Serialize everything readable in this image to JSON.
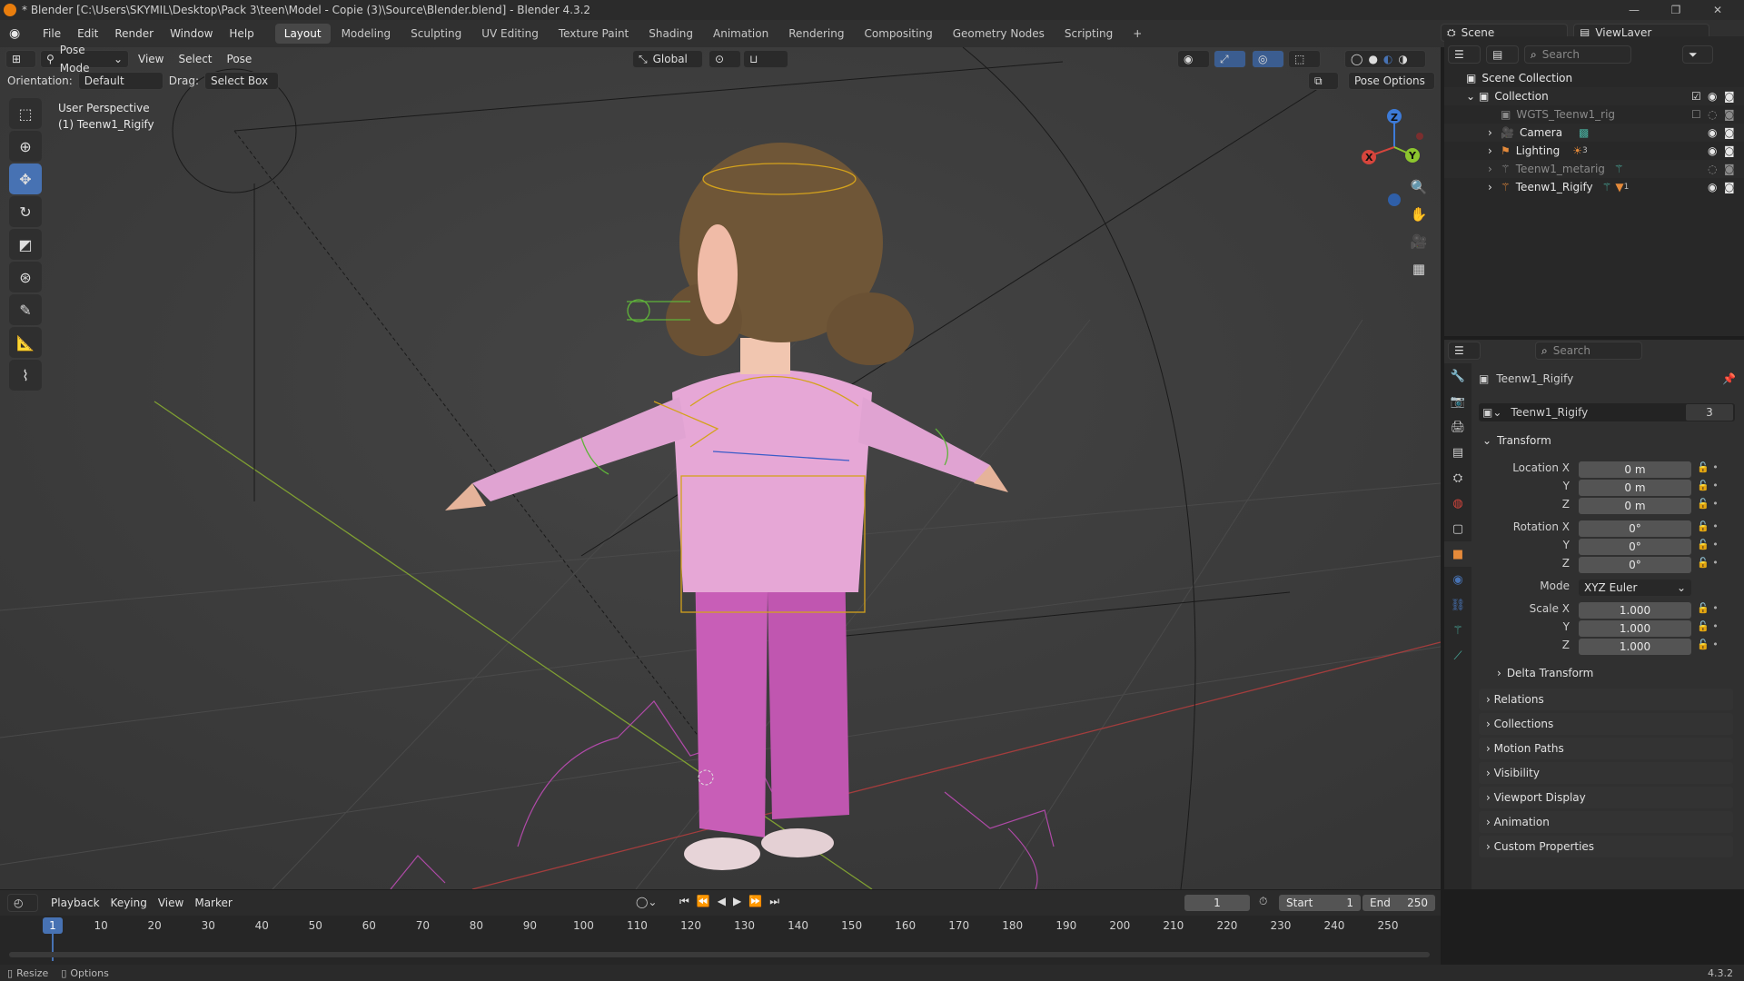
{
  "window": {
    "title": "* Blender [C:\\Users\\SKYMIL\\Desktop\\Pack 3\\teen\\Model - Copie (3)\\Source\\Blender.blend] - Blender 4.3.2",
    "minimize": "—",
    "maximize": "❐",
    "close": "✕"
  },
  "menus": [
    "File",
    "Edit",
    "Render",
    "Window",
    "Help"
  ],
  "workspaces": [
    "Layout",
    "Modeling",
    "Sculpting",
    "UV Editing",
    "Texture Paint",
    "Shading",
    "Animation",
    "Rendering",
    "Compositing",
    "Geometry Nodes",
    "Scripting"
  ],
  "active_workspace": "Layout",
  "add_workspace": "+",
  "scene": {
    "name": "Scene",
    "view_layer": "ViewLayer"
  },
  "viewport": {
    "mode": "Pose Mode",
    "menus": [
      "View",
      "Select",
      "Pose"
    ],
    "transform_orientation": "Global",
    "orientation_label": "Orientation:",
    "orientation_value": "Default",
    "drag_label": "Drag:",
    "drag_value": "Select Box",
    "pose_options": "Pose Options",
    "overlay_perspective": "User Perspective",
    "overlay_object": "(1) Teenw1_Rigify",
    "gizmo": {
      "x": "X",
      "y": "Y",
      "z": "Z"
    }
  },
  "outliner": {
    "search_placeholder": "Search",
    "scene_collection": "Scene Collection",
    "items": [
      {
        "name": "Collection",
        "icon": "collection-icon"
      },
      {
        "name": "WGTS_Teenw1_rig",
        "icon": "collection-icon"
      },
      {
        "name": "Camera",
        "icon": "camera-icon"
      },
      {
        "name": "Lighting",
        "icon": "light-icon",
        "badge": "3"
      },
      {
        "name": "Teenw1_metarig",
        "icon": "armature-icon"
      },
      {
        "name": "Teenw1_Rigify",
        "icon": "armature-icon",
        "badge": "1"
      }
    ]
  },
  "properties": {
    "search_placeholder": "Search",
    "object_name_header": "Teenw1_Rigify",
    "data_name": "Teenw1_Rigify",
    "users": "3",
    "transform_title": "Transform",
    "location_label": "Location X",
    "rotation_label": "Rotation X",
    "scale_label": "Scale X",
    "y_label": "Y",
    "z_label": "Z",
    "location": [
      "0 m",
      "0 m",
      "0 m"
    ],
    "rotation": [
      "0°",
      "0°",
      "0°"
    ],
    "mode_label": "Mode",
    "mode_value": "XYZ Euler",
    "scale": [
      "1.000",
      "1.000",
      "1.000"
    ],
    "delta_transform": "Delta Transform",
    "sections": [
      "Relations",
      "Collections",
      "Motion Paths",
      "Visibility",
      "Viewport Display",
      "Animation",
      "Custom Properties"
    ]
  },
  "timeline": {
    "menus": [
      "Playback",
      "Keying",
      "View",
      "Marker"
    ],
    "current_frame": "1",
    "start_label": "Start",
    "start": "1",
    "end_label": "End",
    "end": "250",
    "ticks": [
      "1",
      "10",
      "20",
      "30",
      "40",
      "50",
      "60",
      "70",
      "80",
      "90",
      "100",
      "110",
      "120",
      "130",
      "140",
      "150",
      "160",
      "170",
      "180",
      "190",
      "200",
      "210",
      "220",
      "230",
      "240",
      "250"
    ]
  },
  "statusbar": {
    "left1": "Resize",
    "left2": "Options",
    "version": "4.3.2"
  },
  "colors": {
    "accent": "#4772b3",
    "x_axis": "#d6453c",
    "y_axis": "#8cc62e",
    "z_axis": "#3d7bd8",
    "pose_bones": "#d4a21c"
  }
}
